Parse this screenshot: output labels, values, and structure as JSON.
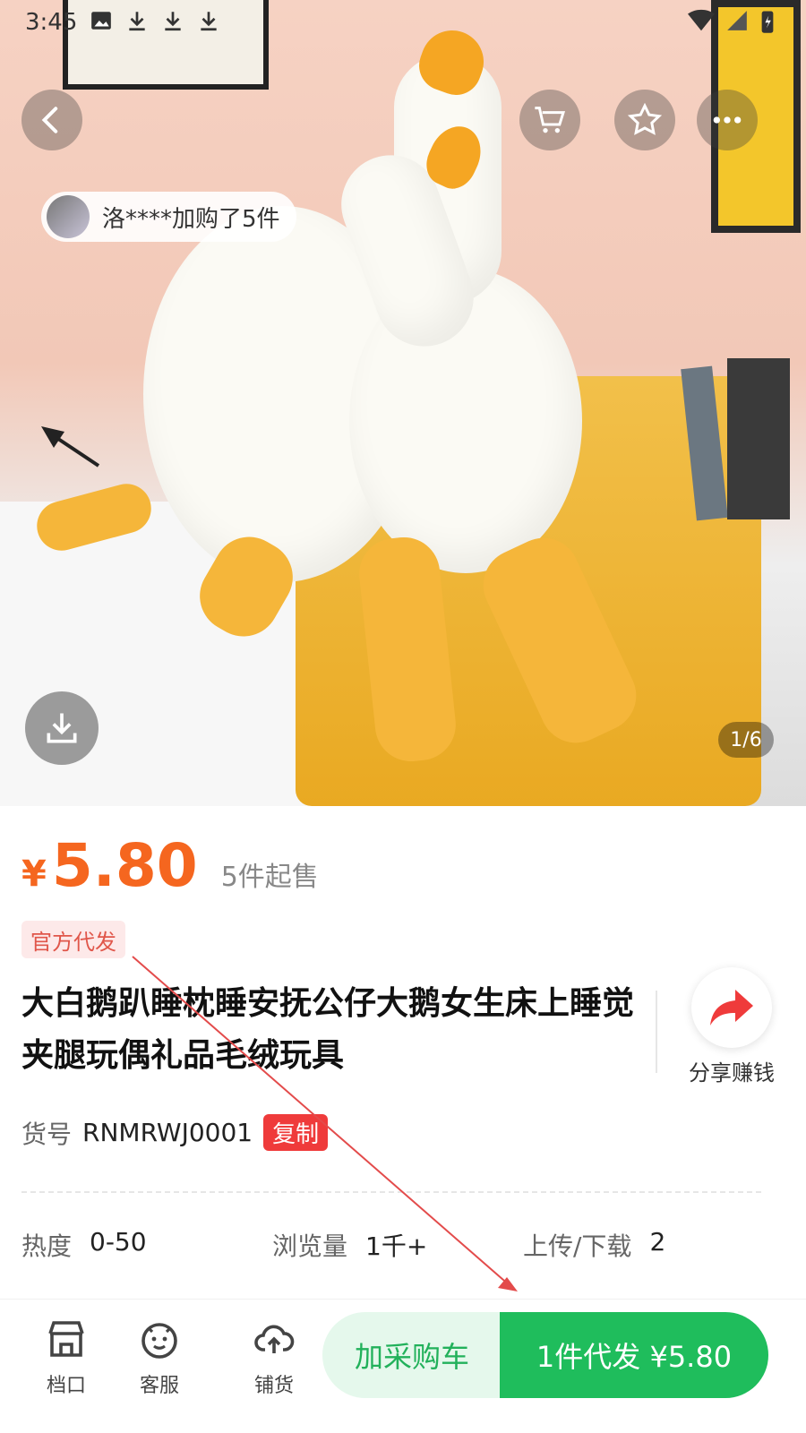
{
  "status_bar": {
    "time": "3:45"
  },
  "hero": {
    "buyer_toast": "洛****加购了5件",
    "page_indicator": "1/6"
  },
  "top_actions": {
    "back": "back-icon",
    "cart": "cart-icon",
    "favorite": "star-icon",
    "more": "more-icon"
  },
  "product": {
    "currency": "¥",
    "price": "5.80",
    "moq": "5件起售",
    "badge": "官方代发",
    "title": "大白鹅趴睡枕睡安抚公仔大鹅女生床上睡觉夹腿玩偶礼品毛绒玩具",
    "share_label": "分享赚钱",
    "sku_label": "货号",
    "sku_value": "RNMRWJ0001",
    "copy_label": "复制"
  },
  "stats": [
    {
      "label": "热度",
      "value": "0-50"
    },
    {
      "label": "浏览量",
      "value": "1千+"
    },
    {
      "label": "上传/下载",
      "value": "2"
    }
  ],
  "bottom_bar": {
    "tabs": [
      {
        "label": "档口",
        "icon": "store-icon"
      },
      {
        "label": "客服",
        "icon": "service-icon"
      },
      {
        "label": "铺货",
        "icon": "upload-cloud-icon"
      }
    ],
    "add_to_cart": "加采购车",
    "buy_now": "1件代发 ¥5.80"
  },
  "colors": {
    "price": "#f5661f",
    "primary_green": "#1fbd5c",
    "copy_red": "#ef3b3b"
  }
}
